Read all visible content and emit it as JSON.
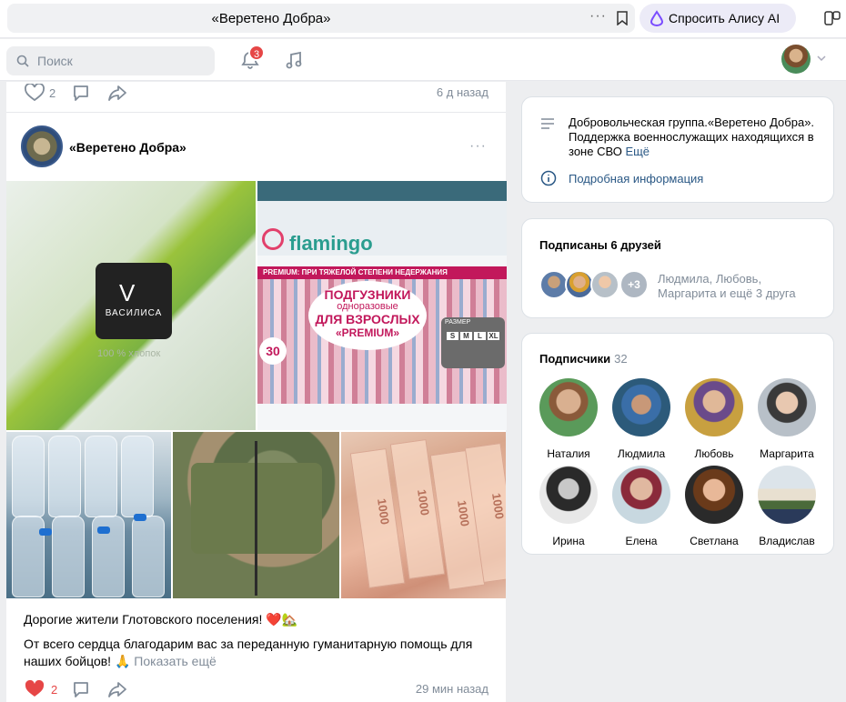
{
  "browser": {
    "tab_title": "«Веретено Добра»",
    "alice_label": "Спросить Алису AI"
  },
  "header": {
    "search_placeholder": "Поиск",
    "notifications_count": "3"
  },
  "feed": {
    "prev_post": {
      "likes": "2",
      "time": "6 д назад"
    },
    "post": {
      "group_name": "«Веретено Добра»",
      "photo_texts": {
        "brand": "ВАСИЛИСА",
        "cotton": "100 % хлопок",
        "flamingo": "flamingo",
        "premium_strip": "PREMIUM: ПРИ ТЯЖЕЛОЙ СТЕПЕНИ НЕДЕРЖАНИЯ",
        "pack_line1": "ПОДГУЗНИКИ",
        "pack_line2": "одноразовые",
        "pack_line3": "ДЛЯ ВЗРОСЛЫХ",
        "pack_line4": "«PREMIUM»",
        "pack_count": "30",
        "size_label": "РАЗМЕР",
        "sizes": [
          "S",
          "M",
          "L",
          "XL"
        ],
        "bill_value": "1000"
      },
      "text_line1": "Дорогие жители Глотовского поселения! ❤️🏡",
      "text_line2": "От всего сердца благодарим вас за переданную гуманитарную помощь для наших бойцов! 🙏",
      "show_more": "Показать ещё",
      "likes": "2",
      "time": "29 мин назад"
    }
  },
  "about": {
    "text": "Добровольческая группа.«Веретено Добра». Поддержка военнослужащих находящихся в зоне СВО",
    "more": "Ещё",
    "info_link": "Подробная информация"
  },
  "friends": {
    "title": "Подписаны 6 друзей",
    "more_badge": "+3",
    "names": "Людмила, Любовь, Маргарита и ещё 3 друга"
  },
  "subscribers": {
    "title": "Подписчики",
    "count": "32",
    "people": [
      {
        "name": "Наталия"
      },
      {
        "name": "Людмила"
      },
      {
        "name": "Любовь"
      },
      {
        "name": "Маргарита"
      },
      {
        "name": "Ирина"
      },
      {
        "name": "Елена"
      },
      {
        "name": "Светлана"
      },
      {
        "name": "Владислав"
      }
    ]
  },
  "colors": {
    "link": "#2a5885",
    "badge": "#e64646",
    "like_active": "#e64646",
    "muted": "#818c99"
  }
}
